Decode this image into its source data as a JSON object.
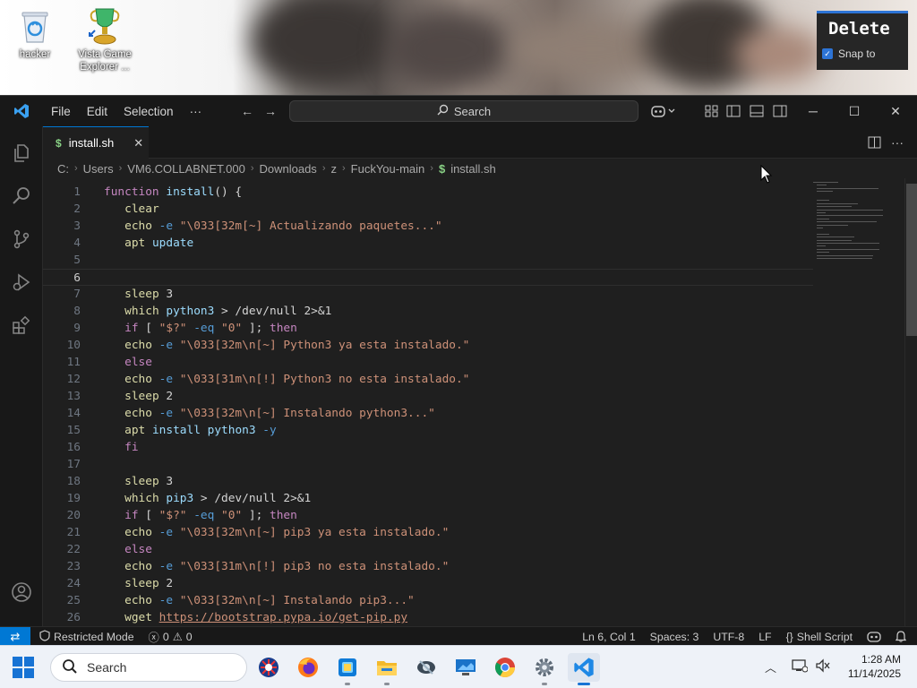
{
  "desktop": {
    "icons": [
      {
        "label": "hacker",
        "icon": "recycle-bin-icon"
      },
      {
        "label": "Vista Game Explorer ...",
        "icon": "trophy-icon"
      }
    ],
    "delete_card": {
      "title": "Delete",
      "snap_label": "Snap to",
      "snap_checked": true
    }
  },
  "window": {
    "menu": [
      "File",
      "Edit",
      "Selection",
      "···"
    ],
    "search_placeholder": "Search"
  },
  "editor_tab": {
    "label": "install.sh",
    "icon": "shell-dollar-icon"
  },
  "breadcrumb": [
    "C:",
    "Users",
    "VM6.COLLABNET.000",
    "Downloads",
    "z",
    "FuckYou-main",
    "install.sh"
  ],
  "editor": {
    "current_line": 6,
    "lines": [
      {
        "n": "1",
        "text": "function install() {"
      },
      {
        "n": "2",
        "text": "   clear"
      },
      {
        "n": "3",
        "text": "   echo -e \"\\033[32m[~] Actualizando paquetes...\""
      },
      {
        "n": "4",
        "text": "   apt update"
      },
      {
        "n": "5",
        "text": ""
      },
      {
        "n": "6",
        "text": ""
      },
      {
        "n": "7",
        "text": "   sleep 3"
      },
      {
        "n": "8",
        "text": "   which python3 > /dev/null 2>&1"
      },
      {
        "n": "9",
        "text": "   if [ \"$?\" -eq \"0\" ]; then"
      },
      {
        "n": "10",
        "text": "   echo -e \"\\033[32m\\n[~] Python3 ya esta instalado.\""
      },
      {
        "n": "11",
        "text": "   else"
      },
      {
        "n": "12",
        "text": "   echo -e \"\\033[31m\\n[!] Python3 no esta instalado.\""
      },
      {
        "n": "13",
        "text": "   sleep 2"
      },
      {
        "n": "14",
        "text": "   echo -e \"\\033[32m\\n[~] Instalando python3...\""
      },
      {
        "n": "15",
        "text": "   apt install python3 -y"
      },
      {
        "n": "16",
        "text": "   fi"
      },
      {
        "n": "17",
        "text": ""
      },
      {
        "n": "18",
        "text": "   sleep 3"
      },
      {
        "n": "19",
        "text": "   which pip3 > /dev/null 2>&1"
      },
      {
        "n": "20",
        "text": "   if [ \"$?\" -eq \"0\" ]; then"
      },
      {
        "n": "21",
        "text": "   echo -e \"\\033[32m\\n[~] pip3 ya esta instalado.\""
      },
      {
        "n": "22",
        "text": "   else"
      },
      {
        "n": "23",
        "text": "   echo -e \"\\033[31m\\n[!] pip3 no esta instalado.\""
      },
      {
        "n": "24",
        "text": "   sleep 2"
      },
      {
        "n": "25",
        "text": "   echo -e \"\\033[32m\\n[~] Instalando pip3...\""
      },
      {
        "n": "26",
        "text": "   wget https://bootstrap.pypa.io/get-pip.py"
      }
    ]
  },
  "status": {
    "restricted": "Restricted Mode",
    "errors": "0",
    "warnings": "0",
    "position": "Ln 6, Col 1",
    "spaces": "Spaces: 3",
    "encoding": "UTF-8",
    "eol": "LF",
    "language": "Shell Script"
  },
  "taskbar": {
    "search_placeholder": "Search",
    "apps": [
      "edge-beta-icon",
      "firefox-icon",
      "photos-icon",
      "file-explorer-icon",
      "wifi-tool-icon",
      "remote-desktop-icon",
      "chrome-icon",
      "settings-icon",
      "vscode-icon"
    ],
    "time": "1:28 AM",
    "date": "11/14/2025"
  },
  "colors": {
    "accent": "#0078d4",
    "editor_bg": "#1f1f1f",
    "keyword": "#c586c0",
    "string": "#ce9178"
  }
}
